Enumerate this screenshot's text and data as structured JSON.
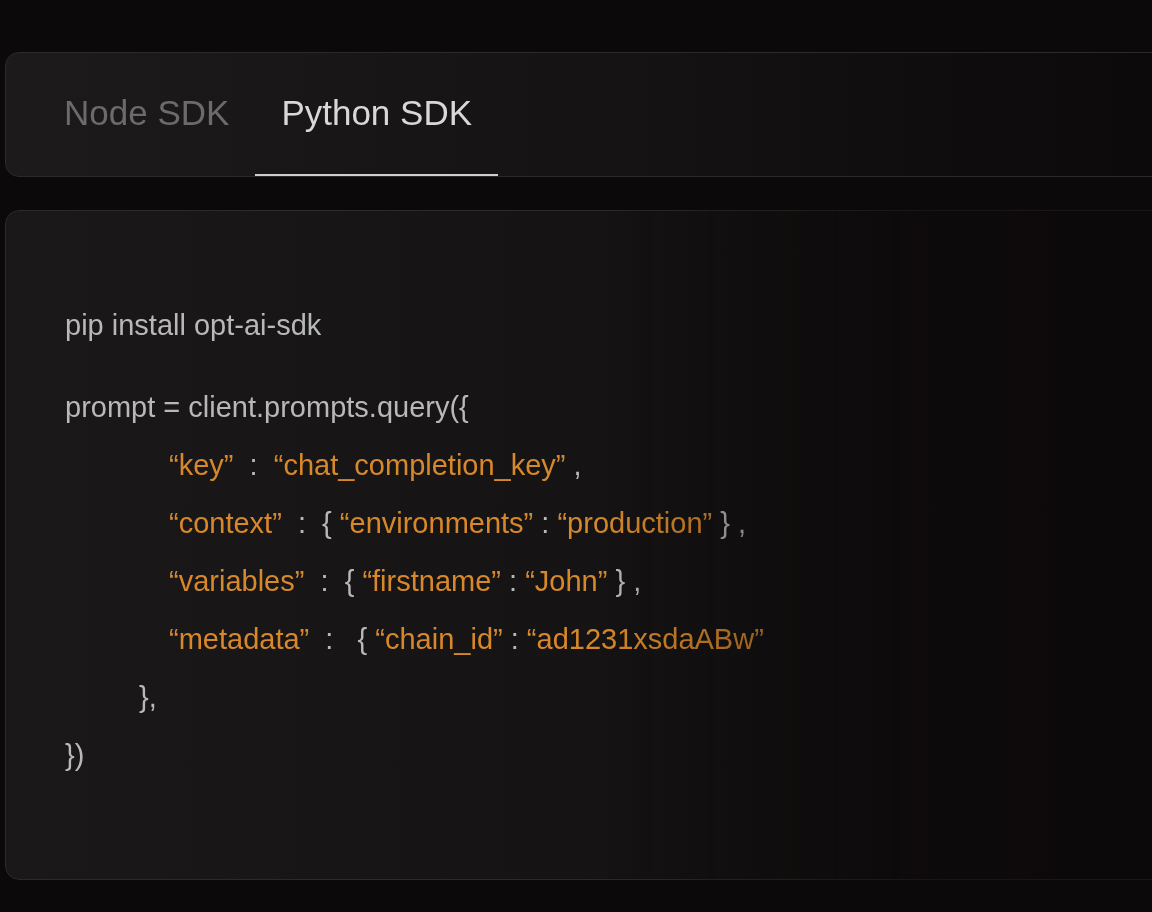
{
  "tabs": [
    {
      "label": "Node SDK",
      "selected": false
    },
    {
      "label": "Python SDK",
      "selected": true
    }
  ],
  "code": {
    "install": "pip install opt-ai-sdk",
    "statement": {
      "open": "prompt = client.prompts.query({",
      "body": {
        "entries": [
          [
            {
              "kind": "string",
              "text": "“key”"
            },
            {
              "kind": "plain",
              "text": "  :  "
            },
            {
              "kind": "string",
              "text": "“chat_completion_key”"
            },
            {
              "kind": "plain",
              "text": " ,"
            }
          ],
          [
            {
              "kind": "string",
              "text": "“context”"
            },
            {
              "kind": "plain",
              "text": "  :  { "
            },
            {
              "kind": "string",
              "text": "“environments”"
            },
            {
              "kind": "plain",
              "text": " : "
            },
            {
              "kind": "string",
              "text": "“production”"
            },
            {
              "kind": "plain",
              "text": " } ,"
            }
          ],
          [
            {
              "kind": "string",
              "text": "“variables”"
            },
            {
              "kind": "plain",
              "text": "  :  { "
            },
            {
              "kind": "string",
              "text": "“firstname”"
            },
            {
              "kind": "plain",
              "text": " : "
            },
            {
              "kind": "string",
              "text": "“John”"
            },
            {
              "kind": "plain",
              "text": " } ,"
            }
          ],
          [
            {
              "kind": "string",
              "text": "“metadata”"
            },
            {
              "kind": "plain",
              "text": "  :   { "
            },
            {
              "kind": "string",
              "text": "“chain_id”"
            },
            {
              "kind": "plain",
              "text": " : "
            },
            {
              "kind": "string",
              "text": "“ad1231xsdaABw”"
            }
          ]
        ],
        "close": "},"
      },
      "close": "})"
    }
  }
}
